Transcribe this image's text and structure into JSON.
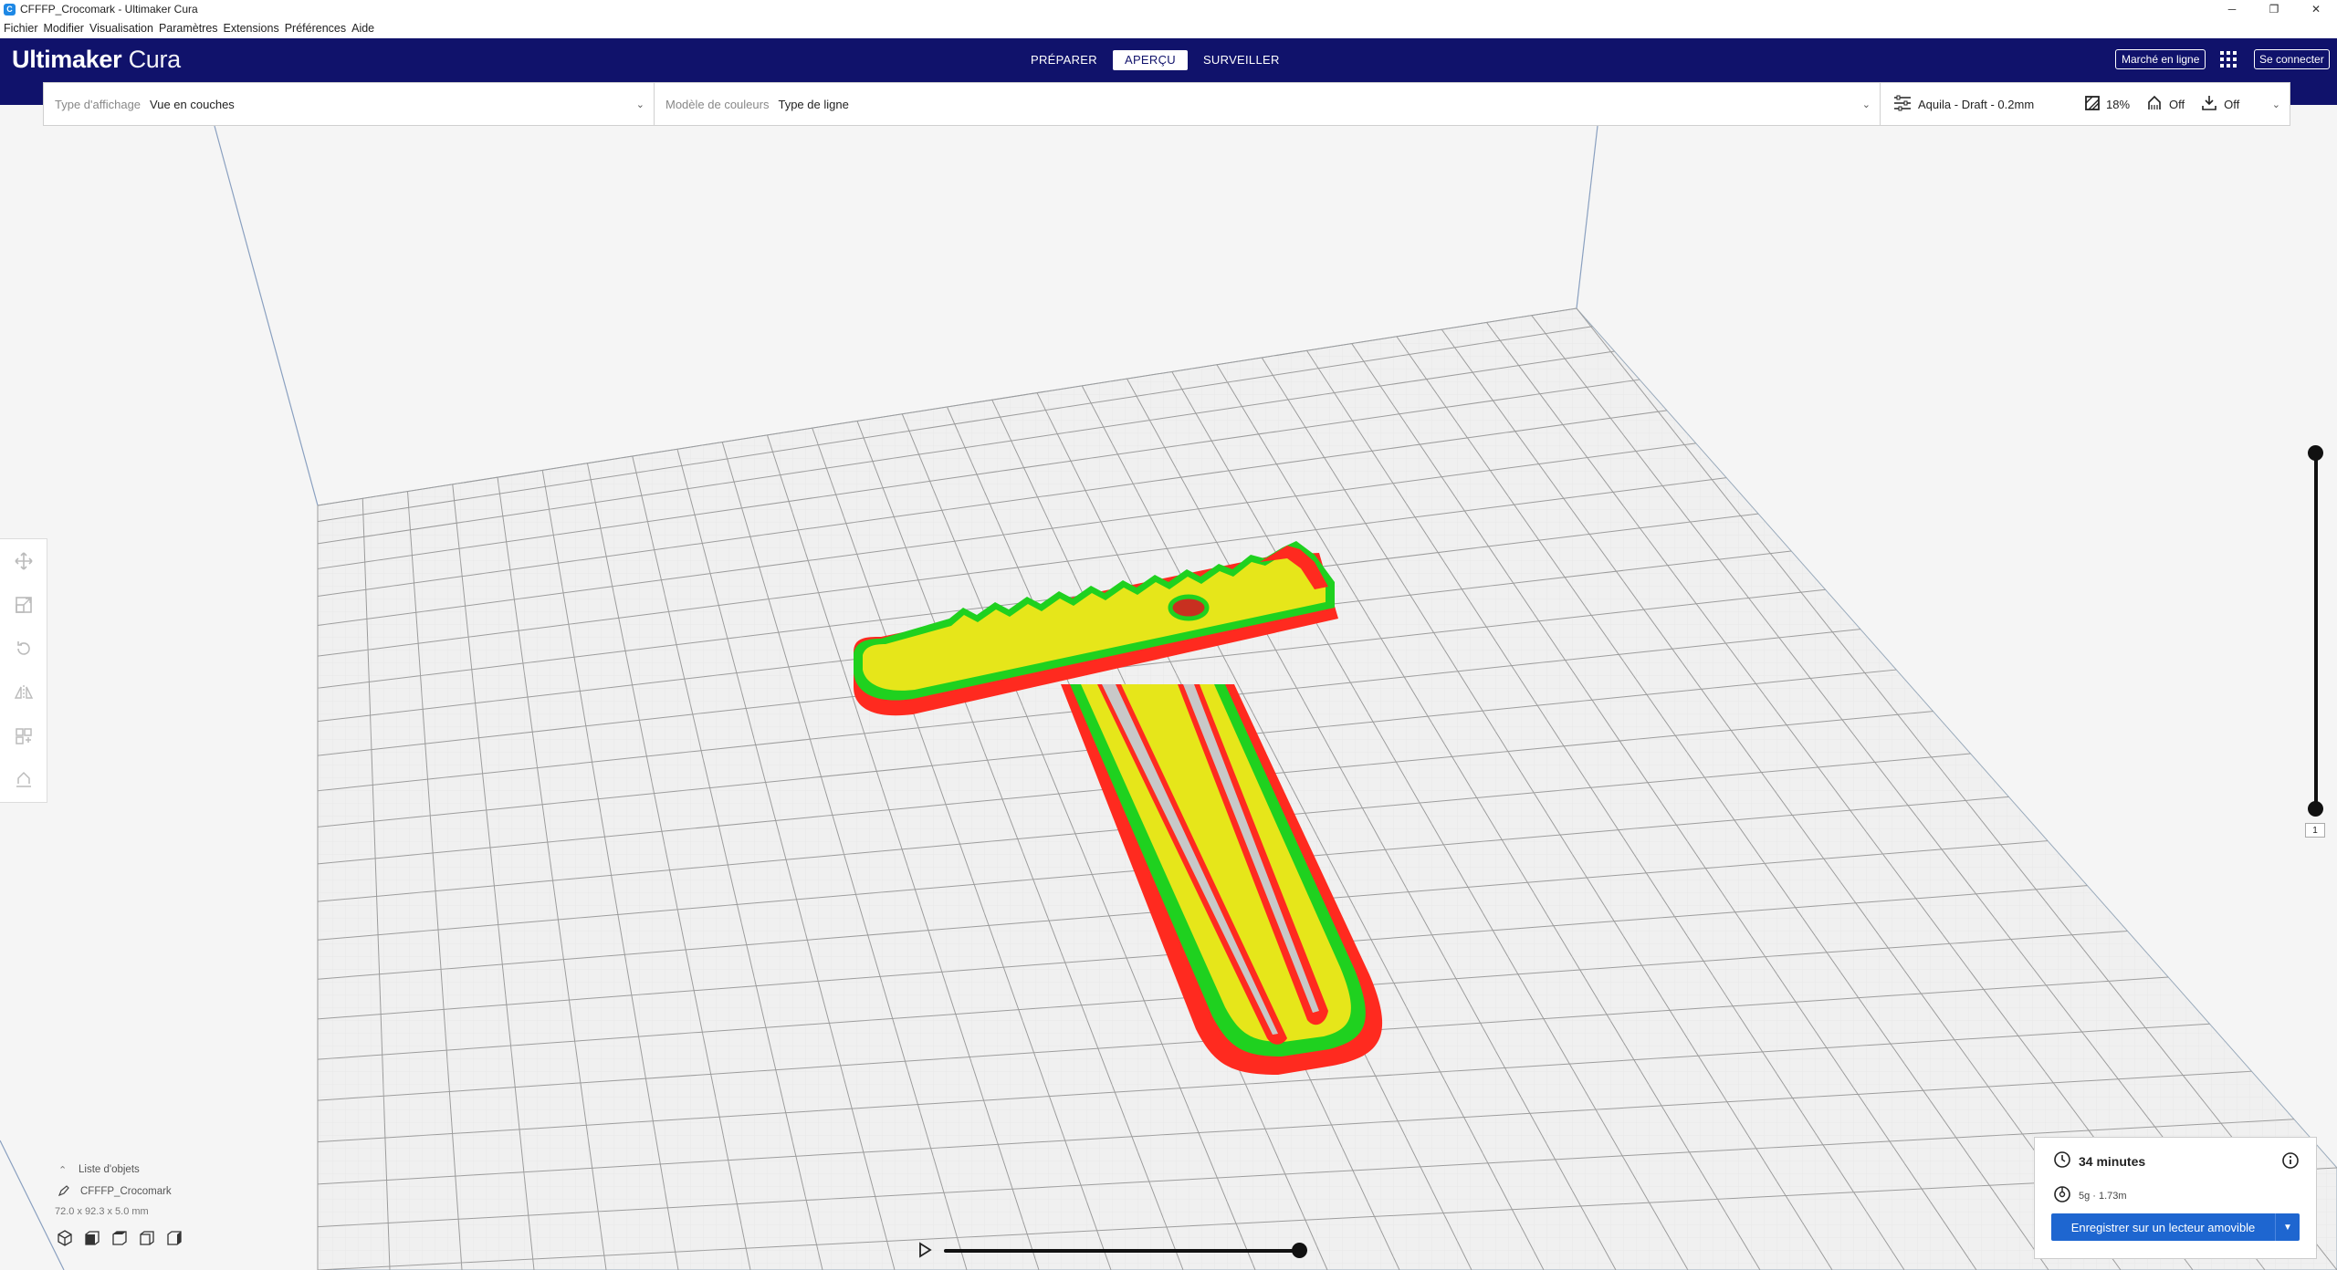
{
  "window": {
    "title": "CFFFP_Crocomark - Ultimaker Cura",
    "controls": {
      "minimize": "─",
      "restore": "❐",
      "close": "✕"
    }
  },
  "menu": [
    "Fichier",
    "Modifier",
    "Visualisation",
    "Paramètres",
    "Extensions",
    "Préférences",
    "Aide"
  ],
  "header": {
    "logo_bold": "Ultimaker",
    "logo_light": "Cura",
    "tabs": [
      "PRÉPARER",
      "APERÇU",
      "SURVEILLER"
    ],
    "active_tab": "APERÇU",
    "marketplace": "Marché en ligne",
    "signin": "Se connecter"
  },
  "viewbar": {
    "view_type_label": "Type d'affichage",
    "view_type_value": "Vue en couches",
    "color_scheme_label": "Modèle de couleurs",
    "color_scheme_value": "Type de ligne",
    "profile": "Aquila - Draft - 0.2mm",
    "infill": "18%",
    "support": "Off",
    "adhesion": "Off"
  },
  "objects": {
    "list_title": "Liste d'objets",
    "name": "CFFFP_Crocomark",
    "dimensions": "72.0 x 92.3 x 5.0 mm"
  },
  "layer_slider": {
    "current_layer": "1"
  },
  "job": {
    "time": "34 minutes",
    "material": "5g · 1.73m",
    "save_button": "Enregistrer sur un lecteur amovible"
  },
  "colors": {
    "header": "#10126b",
    "wall_outer": "#ff2a1f",
    "wall_inner": "#1fd11f",
    "infill": "#e6e61a",
    "button": "#1e66d0"
  },
  "icons": [
    "move-icon",
    "scale-icon",
    "rotate-icon",
    "mirror-icon",
    "per-model-settings-icon",
    "support-blocker-icon",
    "clock-icon",
    "spool-icon",
    "info-icon",
    "settings-sliders-icon",
    "infill-icon",
    "support-icon",
    "adhesion-icon",
    "play-icon",
    "apps-grid-icon",
    "pencil-icon",
    "chevron-up-icon",
    "chevron-down-icon",
    "view-3d-icon",
    "view-front-icon",
    "view-top-icon",
    "view-left-icon",
    "view-right-icon"
  ]
}
